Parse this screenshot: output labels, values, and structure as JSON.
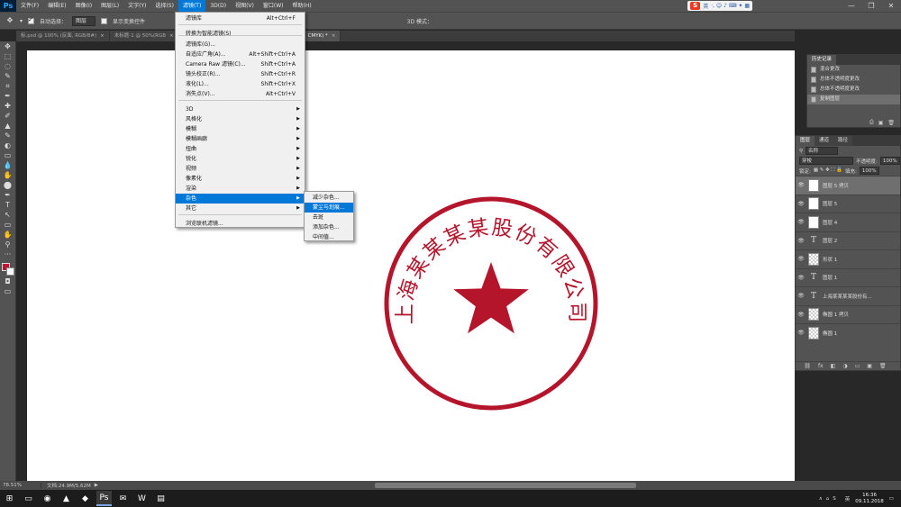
{
  "app": {
    "logo": "Ps"
  },
  "menubar": {
    "items": [
      "文件(F)",
      "编辑(E)",
      "图像(I)",
      "图层(L)",
      "文字(Y)",
      "选择(S)",
      "滤镜(T)",
      "3D(D)",
      "视图(V)",
      "窗口(W)",
      "帮助(H)"
    ],
    "active_index": 6
  },
  "ime": {
    "logo": "S",
    "label": "英",
    "icons": "·, ☺ ♪ ⌨ ✦ ▦"
  },
  "window_controls": {
    "minimize": "—",
    "restore": "❐",
    "close": "✕"
  },
  "options": {
    "auto_select_label": "自动选择：",
    "auto_select_value": "图层",
    "show_transform_label": "显示变换控件",
    "mode_3d_label": "3D 模式："
  },
  "tabs": [
    {
      "label": "标.psd @ 100% (反面, RGB/8#)",
      "close": "×"
    },
    {
      "label": "未标题-1 @ 50%(RGB",
      "close": "×"
    },
    {
      "label": "CMYK) *",
      "close": "×"
    }
  ],
  "toolbox": {
    "tools": [
      "✥",
      "⬚",
      "◌",
      "✎",
      "⌗",
      "✒",
      "✚",
      "✐",
      "▲",
      "✎",
      "◐",
      "▭",
      "💧",
      "✋",
      "⬤",
      "✒",
      "T",
      "↖",
      "▭",
      "✋",
      "⚲",
      "···"
    ]
  },
  "filter_menu": {
    "items": [
      {
        "label": "滤镜库",
        "shortcut": "Alt+Ctrl+F"
      },
      {
        "label": "转换为智能滤镜(S)",
        "shortcut": ""
      },
      {
        "label": "滤镜库(G)...",
        "shortcut": ""
      },
      {
        "label": "自适应广角(A)...",
        "shortcut": "Alt+Shift+Ctrl+A"
      },
      {
        "label": "Camera Raw 滤镜(C)...",
        "shortcut": "Shift+Ctrl+A"
      },
      {
        "label": "镜头校正(R)...",
        "shortcut": "Shift+Ctrl+R"
      },
      {
        "label": "液化(L)...",
        "shortcut": "Shift+Ctrl+X"
      },
      {
        "label": "消失点(V)...",
        "shortcut": "Alt+Ctrl+V"
      },
      {
        "label": "3D",
        "shortcut": ""
      },
      {
        "label": "风格化",
        "shortcut": ""
      },
      {
        "label": "模糊",
        "shortcut": ""
      },
      {
        "label": "模糊画廊",
        "shortcut": ""
      },
      {
        "label": "扭曲",
        "shortcut": ""
      },
      {
        "label": "锐化",
        "shortcut": ""
      },
      {
        "label": "视频",
        "shortcut": ""
      },
      {
        "label": "像素化",
        "shortcut": ""
      },
      {
        "label": "渲染",
        "shortcut": ""
      },
      {
        "label": "杂色",
        "shortcut": ""
      },
      {
        "label": "其它",
        "shortcut": ""
      },
      {
        "label": "浏览联机滤镜...",
        "shortcut": ""
      }
    ],
    "submenu_arrow": "▶"
  },
  "noise_submenu": {
    "items": [
      "减少杂色...",
      "蒙尘与划痕...",
      "去斑",
      "添加杂色...",
      "中间值..."
    ],
    "highlighted_index": 1
  },
  "seal": {
    "text": "上海某某某某股份有限公司",
    "color": "#b5152b"
  },
  "status": {
    "zoom": "78.51%",
    "doc": "文档:24.9M/5.62M",
    "arrow": "▶"
  },
  "history": {
    "tab": "历史记录",
    "items": [
      "混合更改",
      "总体不透明度更改",
      "总体不透明度更改",
      "复制图层"
    ],
    "selected_index": 3,
    "footer_icons": [
      "⎙",
      "▣",
      "🗑"
    ]
  },
  "layers": {
    "tabs": [
      "图层",
      "通道",
      "路径"
    ],
    "kind_label": "名称",
    "blend_mode": "穿梭",
    "opacity_label": "不透明度:",
    "opacity_value": "100%",
    "lock_label": "锁定:",
    "fill_label": "填充:",
    "fill_value": "100%",
    "eye": "👁",
    "items": [
      {
        "name": "图层 5 拷贝",
        "thumb": "white",
        "glyph": ""
      },
      {
        "name": "图层 5",
        "thumb": "white",
        "glyph": ""
      },
      {
        "name": "图层 4",
        "thumb": "white",
        "glyph": ""
      },
      {
        "name": "图层 2",
        "thumb": "type",
        "glyph": "T"
      },
      {
        "name": "形状 1",
        "thumb": "checker",
        "glyph": ""
      },
      {
        "name": "图层 1",
        "thumb": "type",
        "glyph": "T"
      },
      {
        "name": "上海某某某某股份有...",
        "thumb": "type",
        "glyph": "T"
      },
      {
        "name": "椭圆 1 拷贝",
        "thumb": "checker",
        "glyph": ""
      },
      {
        "name": "椭圆 1",
        "thumb": "checker",
        "glyph": ""
      }
    ],
    "selected_index": 0,
    "footer_icons": [
      "⛓",
      "fx",
      "◧",
      "◑",
      "▭",
      "▣",
      "🗑"
    ]
  },
  "taskbar": {
    "start": "⊞",
    "apps": [
      "▭",
      "◉",
      "▲",
      "◆",
      "Ps",
      "✉",
      "W",
      "▤"
    ],
    "active_index": 4,
    "tray_text": "英",
    "tray_icons": [
      "∧",
      "⌂",
      "S"
    ],
    "time": "16:36",
    "date": "09.11.2018"
  }
}
